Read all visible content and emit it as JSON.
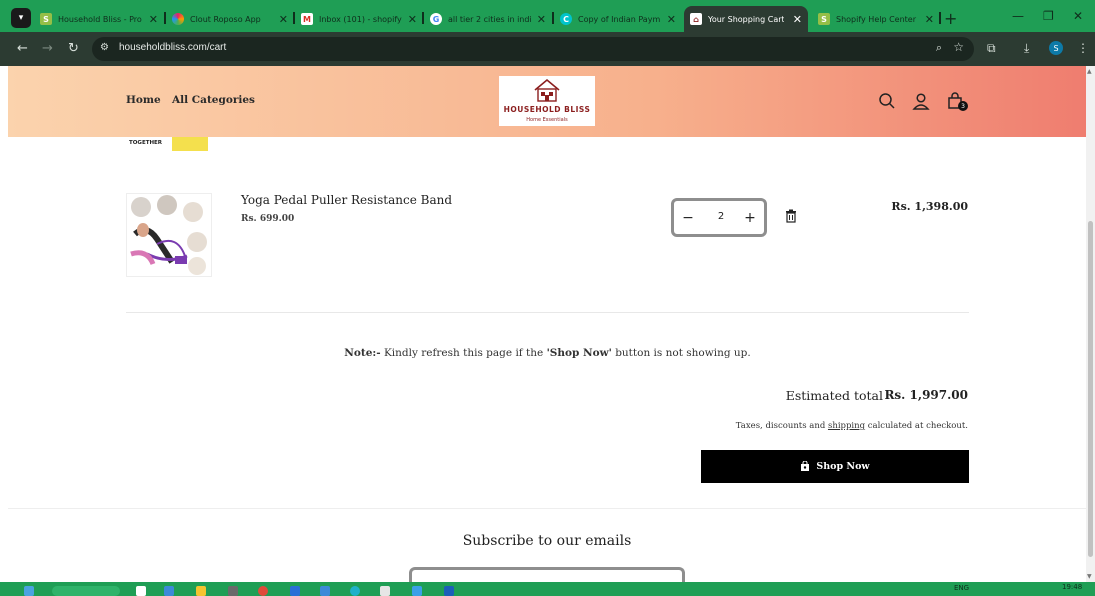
{
  "browser": {
    "tabs": [
      {
        "title": "Household Bliss - Pro",
        "favicon": "shopify-icon",
        "active": false
      },
      {
        "title": "Clout Roposo App",
        "favicon": "roposo-icon",
        "active": false
      },
      {
        "title": "Inbox (101) - shopify",
        "favicon": "gmail-icon",
        "active": false
      },
      {
        "title": "all tier 2 cities in indi",
        "favicon": "google-icon",
        "active": false
      },
      {
        "title": "Copy of Indian Paym",
        "favicon": "canva-icon",
        "active": false
      },
      {
        "title": "Your Shopping Cart",
        "favicon": "store-icon",
        "active": true
      },
      {
        "title": "Shopify Help Center",
        "favicon": "shopify-icon",
        "active": false
      }
    ],
    "url": "householdbliss.com/cart",
    "profile_initial": "S"
  },
  "store": {
    "nav": [
      {
        "label": "Home"
      },
      {
        "label": "All Categories"
      }
    ],
    "logo": {
      "name": "HOUSEHOLD  BLISS",
      "tagline": "Home Essentials"
    },
    "cart_count": "3"
  },
  "prev_item": {
    "image_text": "TOGETHER"
  },
  "cart_item": {
    "name": "Yoga Pedal Puller Resistance Band",
    "unit_price": "Rs. 699.00",
    "quantity": "2",
    "line_total": "Rs. 1,398.00",
    "minus_label": "−",
    "plus_label": "+"
  },
  "note": {
    "prefix": "Note:-",
    "text_1": " Kindly refresh this page if the ",
    "highlight": "'Shop Now'",
    "text_2": " button is not showing up."
  },
  "summary": {
    "estimated_label": "Estimated total",
    "estimated_value": "Rs. 1,997.00",
    "tax_text_1": "Taxes, discounts and ",
    "tax_link": "shipping",
    "tax_text_2": " calculated at checkout.",
    "checkout_label": "Shop Now"
  },
  "footer": {
    "subscribe_heading": "Subscribe to our emails"
  },
  "taskbar": {
    "lang": "ENG",
    "time": "19:48"
  },
  "colors": {
    "tab_strip": "#1f9e55",
    "toolbar": "#2c3b32",
    "header_start": "#fbd3ad",
    "header_end": "#ef7d6f",
    "logo_red": "#8b1e1e",
    "button_black": "#000000"
  }
}
